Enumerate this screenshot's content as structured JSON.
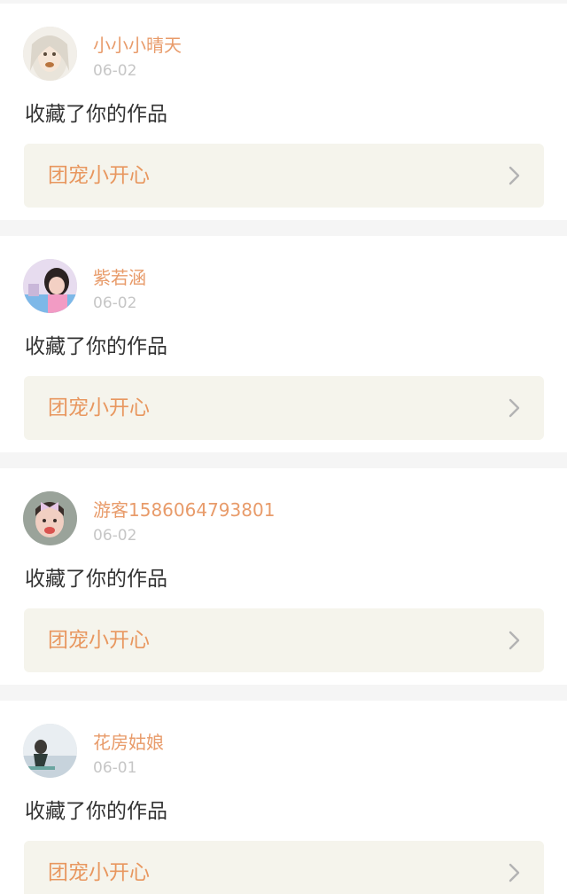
{
  "feed": {
    "items": [
      {
        "username": "小小小晴天",
        "date": "06-02",
        "action": "收藏了你的作品",
        "work_title": "团宠小开心",
        "avatar_icon": "avatar-girl-white-hair-icon",
        "chevron_icon": "chevron-right-icon"
      },
      {
        "username": "紫若涵",
        "date": "06-02",
        "action": "收藏了你的作品",
        "work_title": "团宠小开心",
        "avatar_icon": "avatar-girl-pink-icon",
        "chevron_icon": "chevron-right-icon"
      },
      {
        "username": "游客1586064793801",
        "date": "06-02",
        "action": "收藏了你的作品",
        "work_title": "团宠小开心",
        "avatar_icon": "avatar-child-bow-icon",
        "chevron_icon": "chevron-right-icon"
      },
      {
        "username": "花房姑娘",
        "date": "06-01",
        "action": "收藏了你的作品",
        "work_title": "团宠小开心",
        "avatar_icon": "avatar-figure-seaside-icon",
        "chevron_icon": "chevron-right-icon"
      }
    ]
  },
  "colors": {
    "username": "#e89b6a",
    "work_title": "#e8975f",
    "date": "#c6c6c6",
    "action_text": "#333333",
    "link_background": "#f5f4ec",
    "page_background": "#f5f5f5"
  }
}
